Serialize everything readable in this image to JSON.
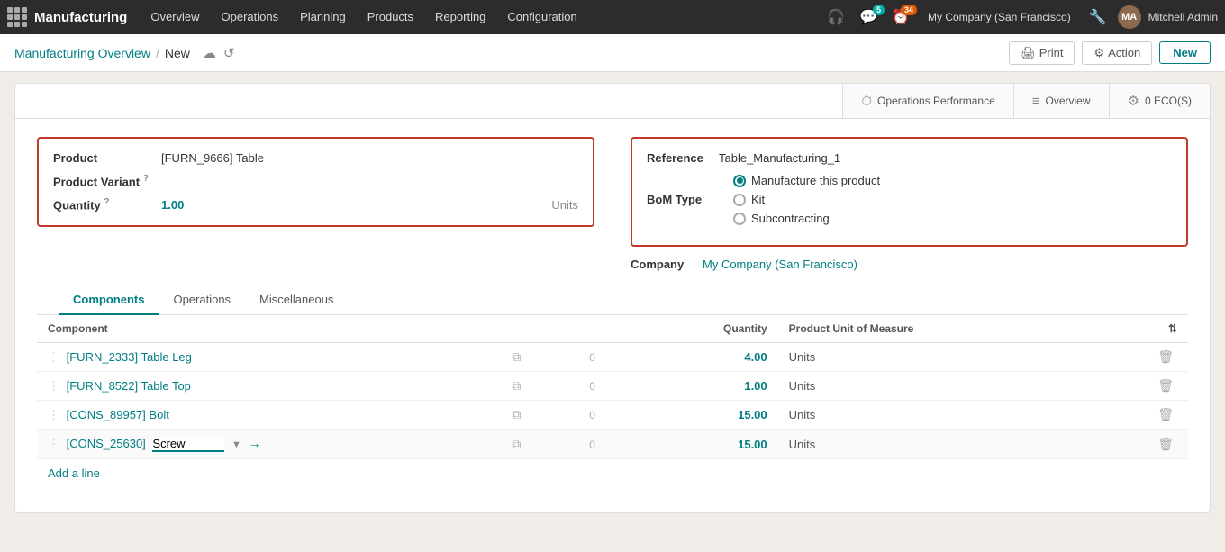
{
  "topnav": {
    "app_name": "Manufacturing",
    "nav_items": [
      "Overview",
      "Operations",
      "Planning",
      "Products",
      "Reporting",
      "Configuration"
    ],
    "chat_badge": "5",
    "activity_badge": "34",
    "company": "My Company (San Francisco)",
    "user_name": "Mitchell Admin",
    "user_initials": "MA"
  },
  "breadcrumb": {
    "parent": "Manufacturing Overview",
    "separator": "/",
    "current": "New"
  },
  "toolbar": {
    "print_label": "Print",
    "action_label": "Action",
    "new_label": "New"
  },
  "card_tabs": [
    {
      "icon": "⏱",
      "label": "Operations Performance"
    },
    {
      "icon": "≡",
      "label": "Overview"
    },
    {
      "icon": "⚙",
      "label": "0 ECO(S)"
    }
  ],
  "product_section": {
    "product_label": "Product",
    "product_value": "[FURN_9666] Table",
    "variant_label": "Product Variant",
    "quantity_label": "Quantity",
    "quantity_value": "1.00",
    "quantity_unit": "Units"
  },
  "reference_section": {
    "reference_label": "Reference",
    "reference_value": "Table_Manufacturing_1",
    "bom_type_label": "BoM Type",
    "bom_options": [
      {
        "label": "Manufacture this product",
        "selected": true
      },
      {
        "label": "Kit",
        "selected": false
      },
      {
        "label": "Subcontracting",
        "selected": false
      }
    ],
    "company_label": "Company",
    "company_value": "My Company (San Francisco)"
  },
  "section_tabs": [
    {
      "label": "Components",
      "active": true
    },
    {
      "label": "Operations",
      "active": false
    },
    {
      "label": "Miscellaneous",
      "active": false
    }
  ],
  "table": {
    "headers": [
      "Component",
      "",
      "",
      "Quantity",
      "Product Unit of Measure",
      ""
    ],
    "rows": [
      {
        "code": "[FURN_2333]",
        "name": "Table Leg",
        "qty_badge": "0",
        "quantity": "4.00",
        "unit": "Units"
      },
      {
        "code": "[FURN_8522]",
        "name": "Table Top",
        "qty_badge": "0",
        "quantity": "1.00",
        "unit": "Units"
      },
      {
        "code": "[CONS_89957]",
        "name": "Bolt",
        "qty_badge": "0",
        "quantity": "15.00",
        "unit": "Units"
      },
      {
        "code": "[CONS_25630]",
        "name": "Screw",
        "qty_badge": "0",
        "quantity": "15.00",
        "unit": "Units",
        "editing": true
      }
    ],
    "add_line_label": "Add a line"
  }
}
